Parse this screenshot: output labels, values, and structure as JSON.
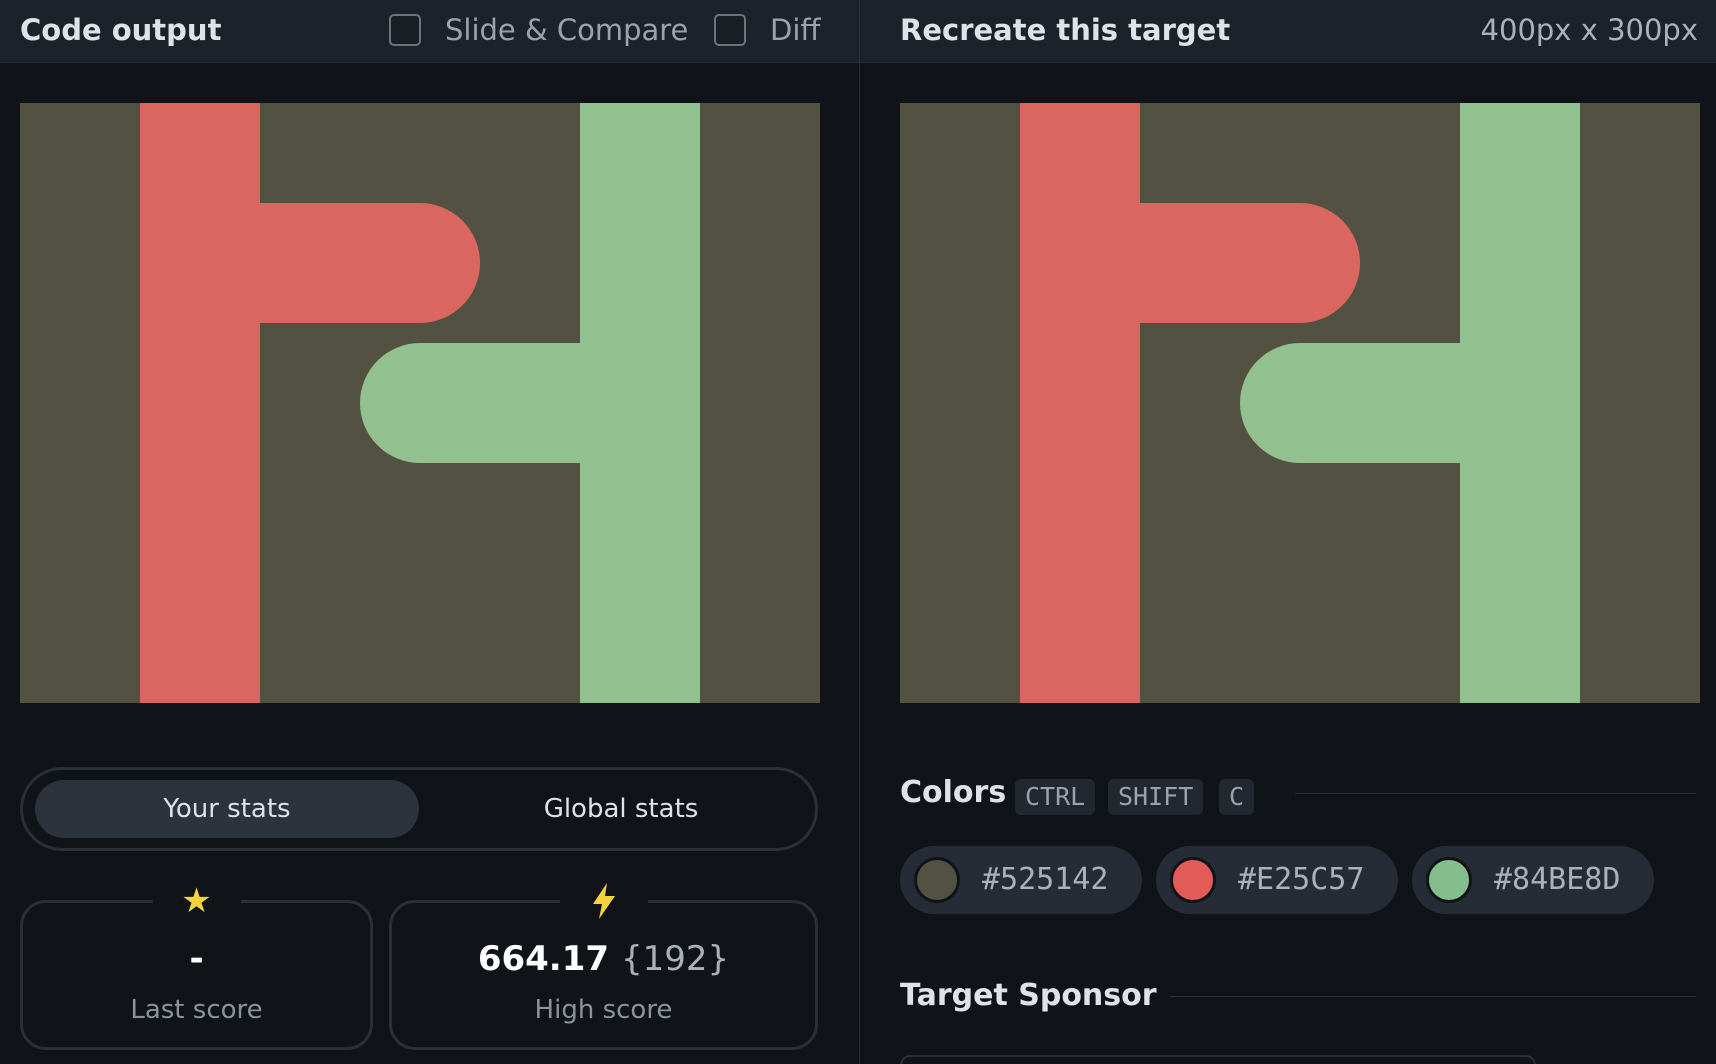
{
  "left_pane": {
    "title": "Code output",
    "slide_compare_label": "Slide & Compare",
    "diff_label": "Diff",
    "stats_tabs": {
      "your_stats": "Your stats",
      "global_stats": "Global stats"
    },
    "last_score": {
      "value": "-",
      "label": "Last score",
      "icon": "star-icon"
    },
    "high_score": {
      "value": "664.17",
      "sub": "{192}",
      "label": "High score",
      "icon": "bolt-icon"
    }
  },
  "right_pane": {
    "title": "Recreate this target",
    "dimensions": "400px x 300px",
    "colors_title": "Colors",
    "shortcut_keys": [
      "CTRL",
      "SHIFT",
      "C"
    ],
    "colors": [
      {
        "hex": "#525142"
      },
      {
        "hex": "#E25C57"
      },
      {
        "hex": "#84BE8D"
      }
    ],
    "sponsor_title": "Target Sponsor"
  },
  "design_colors": {
    "background": "#525142",
    "red": "#D9675F",
    "green": "#93C08F"
  }
}
